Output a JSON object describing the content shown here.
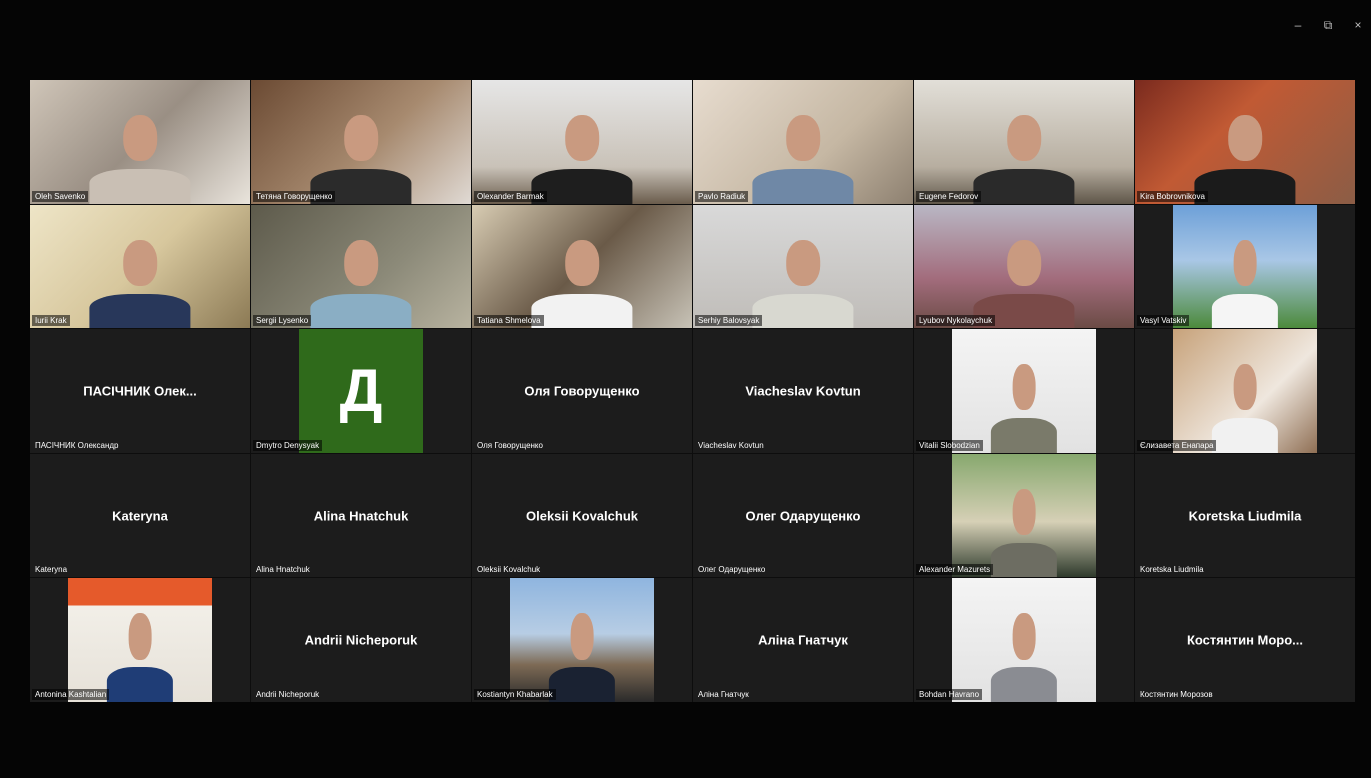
{
  "window": {
    "controls": {
      "minimize": "–",
      "restore": "⧉",
      "close": "×"
    }
  },
  "colors": {
    "background": "#050505",
    "tile": "#1c1c1c",
    "avatar_green": "#2f6a1b"
  },
  "participants": [
    {
      "label": "Oleh Savenko",
      "video": true,
      "bg": "bg-room1",
      "shirt": "#c9bfb4"
    },
    {
      "label": "Тетяна Говорущенко",
      "video": true,
      "bg": "bg-room2",
      "shirt": "#2b2b2b"
    },
    {
      "label": "Olexander Barmak",
      "video": true,
      "bg": "bg-room3",
      "shirt": "#1e1e1e"
    },
    {
      "label": "Pavlo Radiuk",
      "video": true,
      "bg": "bg-room4",
      "shirt": "#6f88a6"
    },
    {
      "label": "Eugene Fedorov",
      "video": true,
      "bg": "bg-room5",
      "shirt": "#2a2a2a"
    },
    {
      "label": "Kira Bobrovnikova",
      "video": true,
      "bg": "bg-room6",
      "shirt": "#1b1b1b"
    },
    {
      "label": "Iurii Krak",
      "video": true,
      "bg": "bg-room7",
      "shirt": "#28375a"
    },
    {
      "label": "Sergii Lysenko",
      "video": true,
      "bg": "bg-room8",
      "shirt": "#8aaec4"
    },
    {
      "label": "Tatiana Shmelova",
      "video": true,
      "bg": "bg-room9",
      "shirt": "#f2f2f2"
    },
    {
      "label": "Serhiy Balovsyak",
      "video": true,
      "bg": "bg-room10",
      "shirt": "#d8d8d0"
    },
    {
      "label": "Lyubov Nykolaychuk",
      "video": true,
      "bg": "bg-room11",
      "shirt": "#7a4a48"
    },
    {
      "label": "Vasyl Vatskiv",
      "video": true,
      "bg": "bg-sky",
      "shirt": "#f5f5f5",
      "boxed": true
    },
    {
      "label": "ПАСІЧНИК Олександр",
      "video": false,
      "display": "ПАСІЧНИК Олек..."
    },
    {
      "label": "Dmytro Denysyak",
      "video": false,
      "avatar_letter": "Д"
    },
    {
      "label": "Оля Говорущенко",
      "video": false,
      "display": "Оля Говорущенко"
    },
    {
      "label": "Viacheslav Kovtun",
      "video": false,
      "display": "Viacheslav Kovtun"
    },
    {
      "label": "Vitalii Slobodzian",
      "video": true,
      "bg": "bg-white",
      "shirt": "#7a7a6a",
      "boxed": true
    },
    {
      "label": "Єлизавета Енапара",
      "video": true,
      "bg": "bg-shelf",
      "shirt": "#f1f1f1",
      "boxed": true
    },
    {
      "label": "Kateryna",
      "video": false,
      "display": "Kateryna"
    },
    {
      "label": "Alina Hnatchuk",
      "video": false,
      "display": "Alina Hnatchuk"
    },
    {
      "label": "Oleksii Kovalchuk",
      "video": false,
      "display": "Oleksii Kovalchuk"
    },
    {
      "label": "Олег Одарущенко",
      "video": false,
      "display": "Олег Одарущенко"
    },
    {
      "label": "Alexander Mazurets",
      "video": true,
      "bg": "bg-garden",
      "shirt": "#6d6d62",
      "boxed": true
    },
    {
      "label": "Koretska Liudmila",
      "video": false,
      "display": "Koretska Liudmila"
    },
    {
      "label": "Antonina Kashtalian",
      "video": true,
      "bg": "bg-orange",
      "shirt": "#1f3d76",
      "boxed": true
    },
    {
      "label": "Andrii Nicheporuk",
      "video": false,
      "display": "Andrii Nicheporuk"
    },
    {
      "label": "Kostiantyn Khabarlak",
      "video": true,
      "bg": "bg-city",
      "shirt": "#1a2232",
      "boxed": true
    },
    {
      "label": "Аліна Гнатчук",
      "video": false,
      "display": "Аліна Гнатчук"
    },
    {
      "label": "Bohdan Havrano",
      "video": true,
      "bg": "bg-white",
      "shirt": "#8a8c92",
      "boxed": true
    },
    {
      "label": "Костянтин Морозов",
      "video": false,
      "display": "Костянтин Моро..."
    }
  ]
}
